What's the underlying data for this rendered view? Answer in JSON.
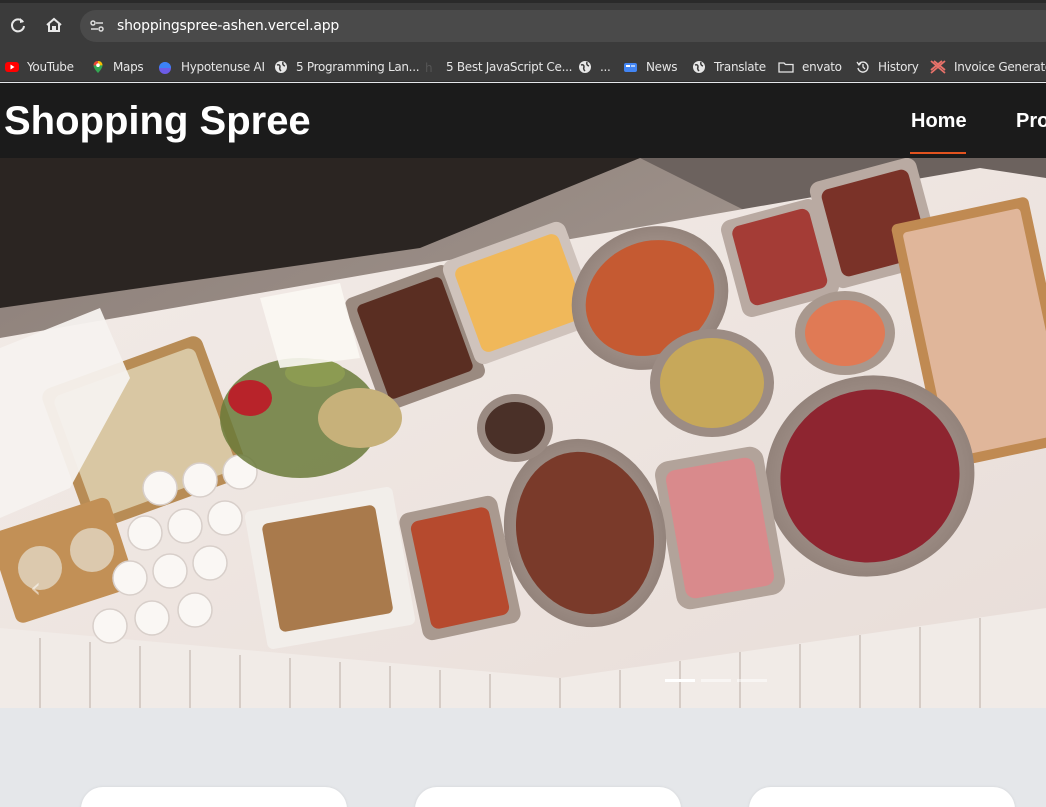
{
  "browser": {
    "url": "shoppingspree-ashen.vercel.app",
    "bookmarks": [
      {
        "label": "YouTube",
        "icon": "youtube-icon"
      },
      {
        "label": "Maps",
        "icon": "maps-icon"
      },
      {
        "label": "Hypotenuse AI",
        "icon": "hypotenuse-icon"
      },
      {
        "label": "5 Programming Lan...",
        "icon": "globe-icon"
      },
      {
        "label": "5 Best JavaScript Ce...",
        "icon": "site-icon"
      },
      {
        "label": "...",
        "icon": "globe-icon"
      },
      {
        "label": "News",
        "icon": "news-icon"
      },
      {
        "label": "Translate",
        "icon": "globe-icon"
      },
      {
        "label": "envato",
        "icon": "folder-icon"
      },
      {
        "label": "History",
        "icon": "history-icon"
      },
      {
        "label": "Invoice Generator",
        "icon": "invoice-icon"
      }
    ]
  },
  "site": {
    "brand": "Shopping Spree",
    "nav": [
      {
        "label": "Home",
        "active": true
      },
      {
        "label": "Pro"
      }
    ],
    "accent_color": "#e2531f"
  },
  "hero": {
    "prev_glyph": "‹",
    "slides": 3,
    "active_slide": 0
  }
}
